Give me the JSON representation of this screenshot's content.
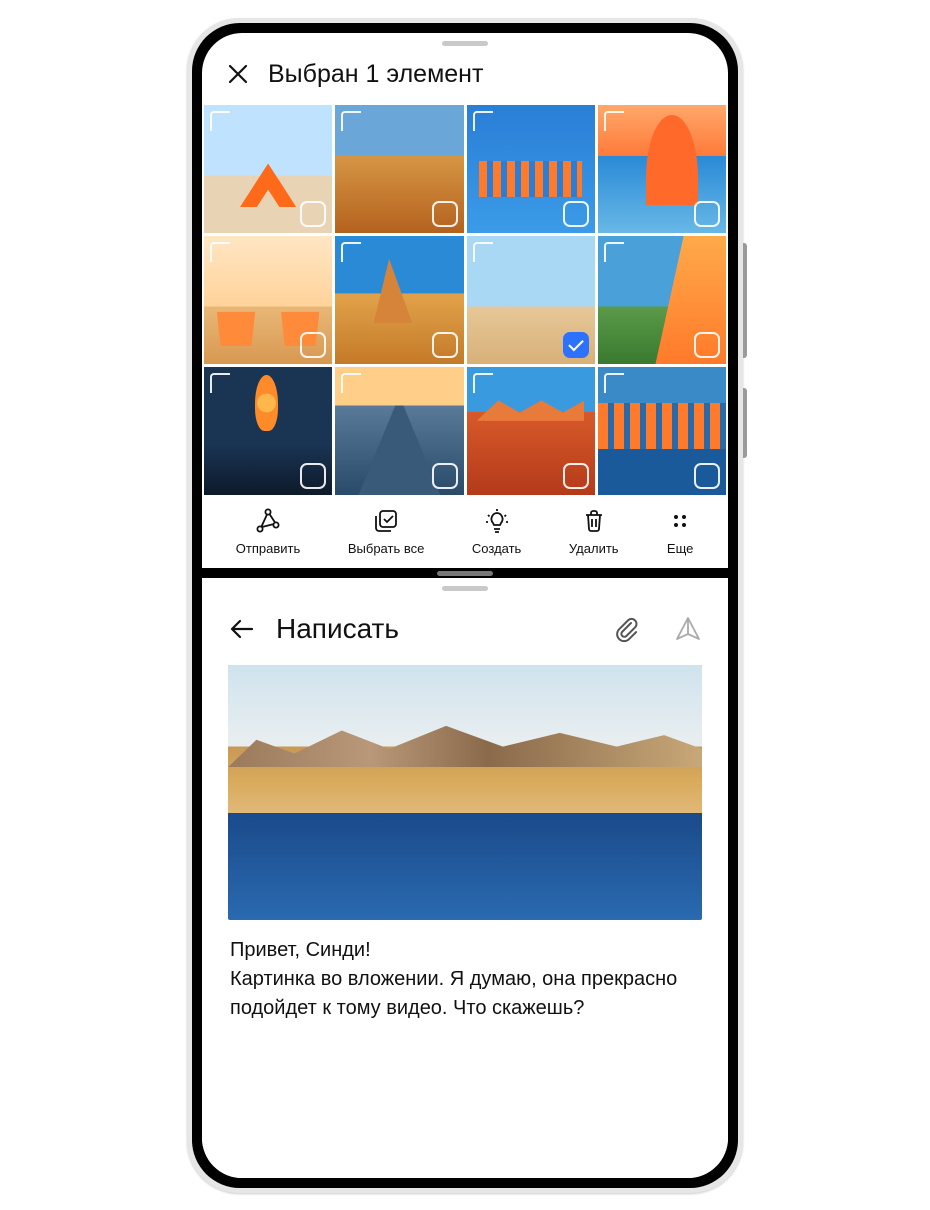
{
  "gallery": {
    "title": "Выбран 1 элемент",
    "selected_index": 6
  },
  "actions": {
    "send": "Отправить",
    "select_all": "Выбрать все",
    "create": "Создать",
    "delete": "Удалить",
    "more": "Еще"
  },
  "compose": {
    "title": "Написать",
    "greeting": "Привет, Синди!",
    "body": "Картинка во вложении. Я думаю, она прекрасно подойдет к тому видео. Что скажешь?"
  }
}
